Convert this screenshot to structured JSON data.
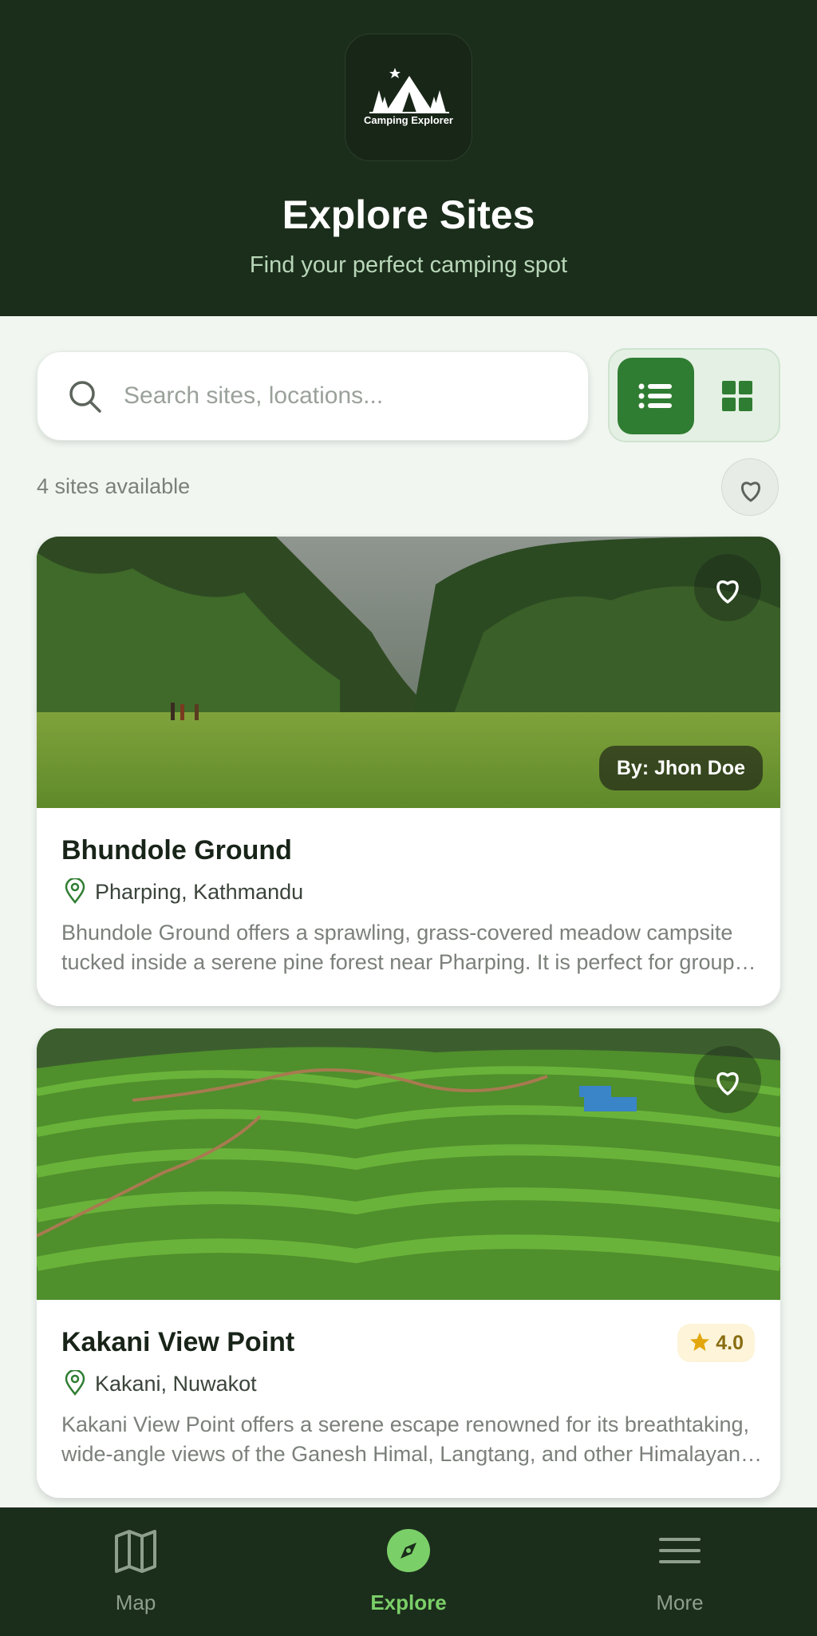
{
  "header": {
    "logo_text": "Camping Explorer",
    "title": "Explore Sites",
    "subtitle": "Find your perfect camping spot"
  },
  "search": {
    "placeholder": "Search sites, locations..."
  },
  "view_toggle": {
    "selected": "list",
    "options": [
      "list",
      "grid"
    ]
  },
  "sites_count": "4 sites available",
  "cards": [
    {
      "title": "Bhundole Ground",
      "location": "Pharping, Kathmandu",
      "description": "Bhundole Ground offers a sprawling, grass-covered meadow campsite tucked inside a serene pine forest near Pharping. It is perfect for groups seeking a peaceful escape.",
      "author": "By: Jhon Doe",
      "favorite": false
    },
    {
      "title": "Kakani View Point",
      "location": "Kakani, Nuwakot",
      "description": "Kakani View Point offers a serene escape renowned for its breathtaking, wide-angle views of the Ganesh Himal, Langtang, and other Himalayan ranges.",
      "rating": "4.0",
      "favorite": false
    }
  ],
  "bottom_nav": {
    "items": [
      {
        "label": "Map",
        "icon": "map-icon",
        "active": false
      },
      {
        "label": "Explore",
        "icon": "compass-icon",
        "active": true
      },
      {
        "label": "More",
        "icon": "menu-icon",
        "active": false
      }
    ]
  },
  "colors": {
    "header_bg": "#1b2d1b",
    "accent": "#2f7d32",
    "active_nav": "#7bcf68",
    "page_bg": "#f1f6f1",
    "rating_star": "#e3a70d"
  }
}
